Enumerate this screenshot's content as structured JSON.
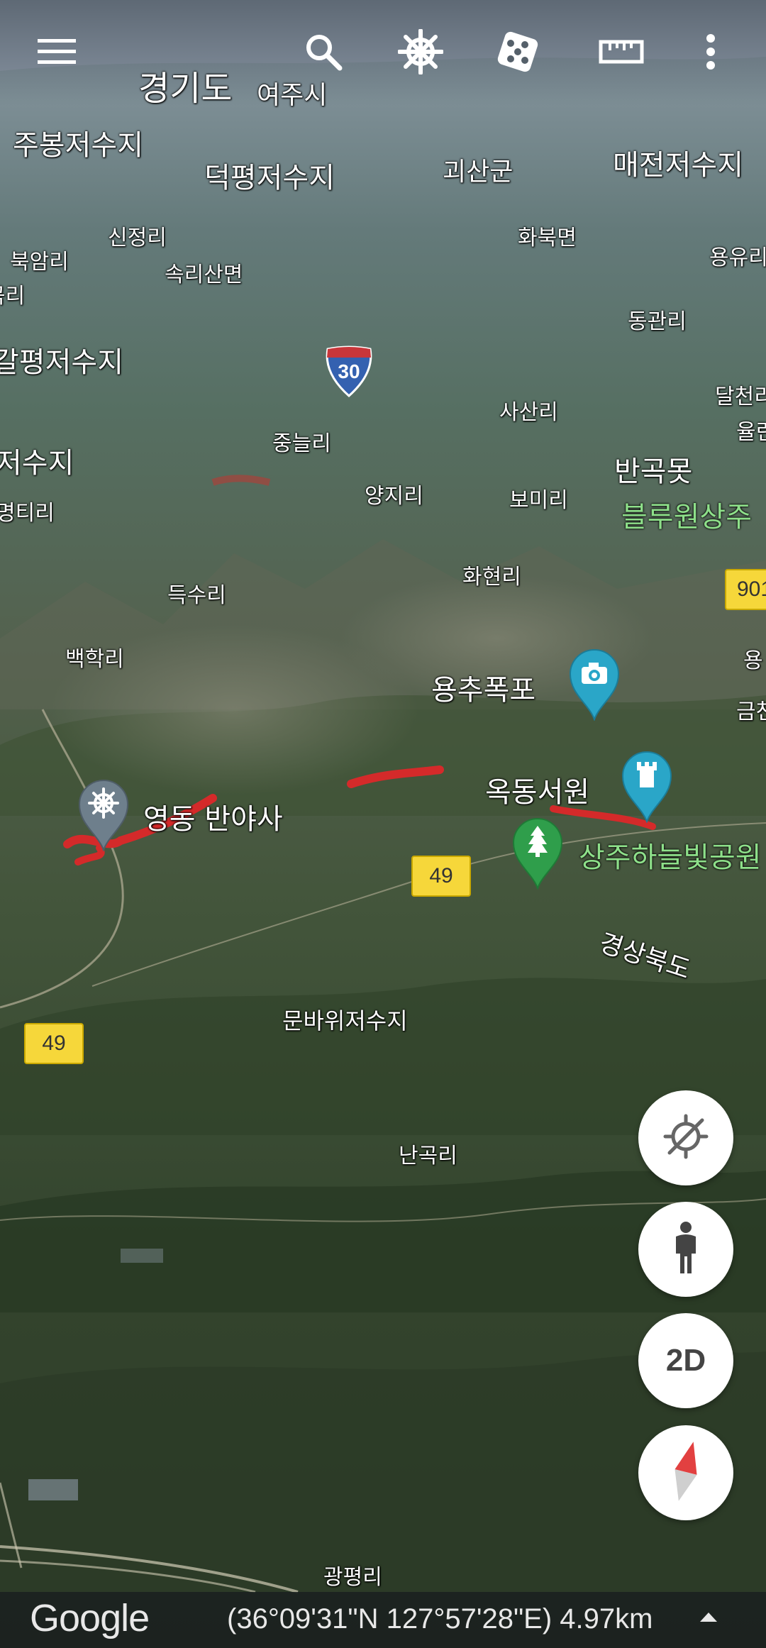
{
  "toolbar": {
    "menu_icon": "hamburger-menu-icon",
    "search_icon": "search-icon",
    "voyager_icon": "ship-wheel-icon",
    "feeling_lucky_icon": "dice-icon",
    "measure_icon": "ruler-icon",
    "more_icon": "more-vertical-icon"
  },
  "map_labels": {
    "gyeonggi": "경기도",
    "yeoju": "여주시",
    "jubong": "주봉저수지",
    "deokpyeong": "덕평저수지",
    "goesan": "괴산군",
    "maejeon": "매전저수지",
    "sinjeong": "신정리",
    "hwabuk": "화북면",
    "bugam": "북암리",
    "sokrisan": "속리산면",
    "yongyu": "용유리",
    "ri_left": "곡리",
    "donggwan": "동관리",
    "galpyeong": "갈평저수지",
    "sasan": "사산리",
    "dalcheon": "달천리",
    "jungneul": "중늘리",
    "ulleuk": "율린",
    "reservoir_left": "저수지",
    "bangokmot": "반곡못",
    "yangji": "양지리",
    "bomi": "보미리",
    "bluone": "블루원상주",
    "myeongti": "명티리",
    "hwahyeon": "화현리",
    "deuksu": "득수리",
    "baekhak": "백학리",
    "yong_right": "용",
    "geum_right": "금천",
    "gyeongbuk": "경상북도",
    "munbawi": "문바위저수지",
    "nangok": "난곡리",
    "gwangpyeong": "광평리"
  },
  "pois": [
    {
      "name": "용추폭포",
      "icon": "camera-icon",
      "color": "#2aa6c8"
    },
    {
      "name": "옥동서원",
      "icon": "tower-icon",
      "color": "#2aa6c8"
    },
    {
      "name": "영동 반야사",
      "icon": "dharma-wheel-icon",
      "color": "#6e7f8c"
    },
    {
      "name": "상주하늘빛공원",
      "icon": "tree-icon",
      "color": "#2f9e4b"
    }
  ],
  "road_shields": {
    "interstate": "30",
    "route_49_a": "49",
    "route_49_b": "49",
    "route_901": "901"
  },
  "fabs": {
    "location_icon": "location-disabled-icon",
    "pegman_icon": "pegman-icon",
    "toggle_2d": "2D",
    "compass_icon": "compass-icon"
  },
  "status": {
    "brand": "Google",
    "coords": "(36°09'31\"N 127°57'28\"E) 4.97km",
    "expand_icon": "caret-up-icon"
  }
}
